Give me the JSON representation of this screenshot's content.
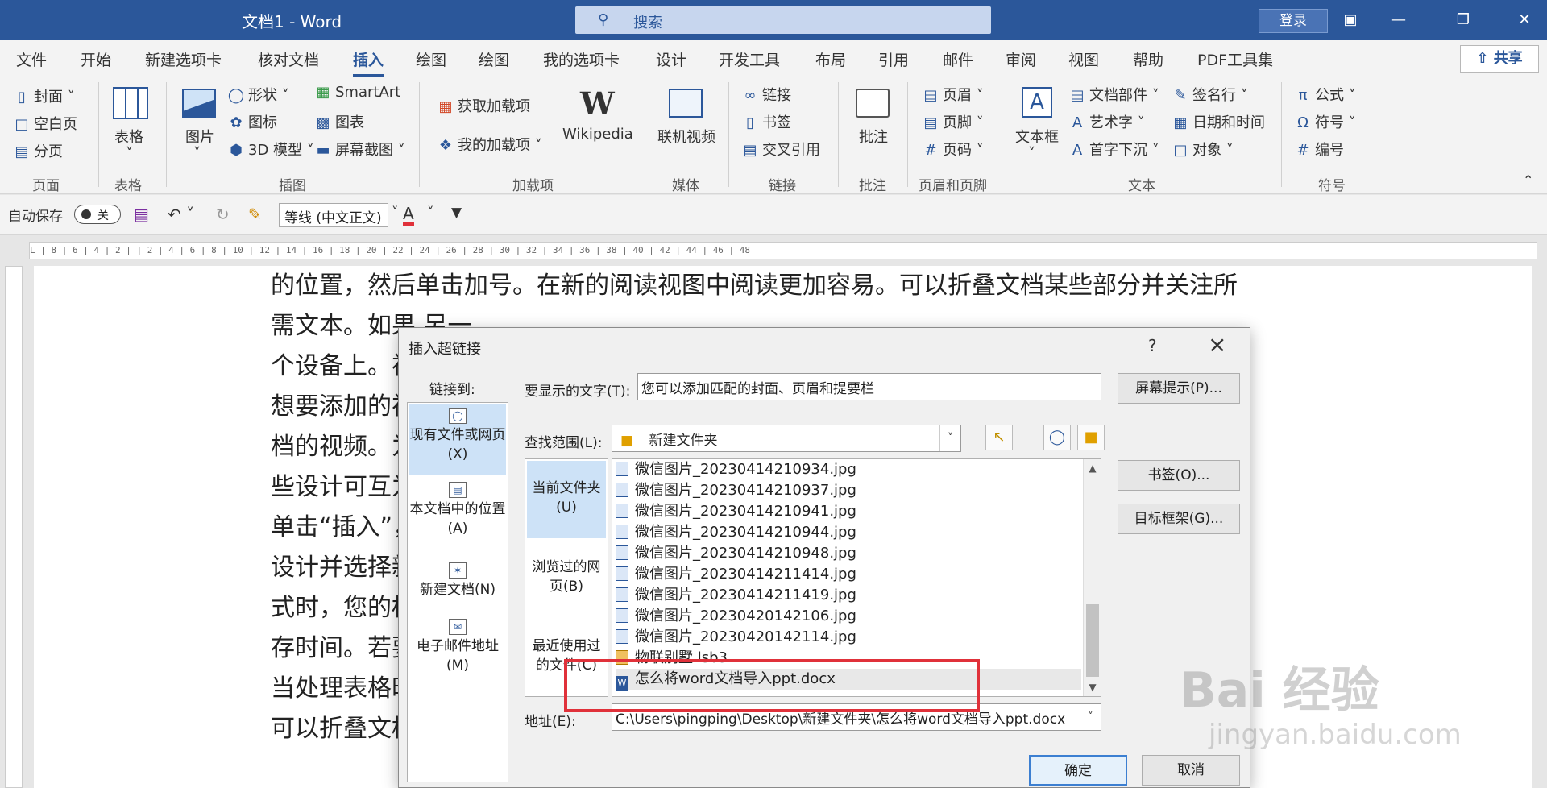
{
  "titlebar": {
    "title": "文档1  -  Word",
    "search_placeholder": "搜索",
    "login": "登录"
  },
  "tabs": [
    "文件",
    "开始",
    "新建选项卡",
    "核对文档",
    "插入",
    "绘图",
    "绘图",
    "我的选项卡",
    "设计",
    "开发工具",
    "布局",
    "引用",
    "邮件",
    "审阅",
    "视图",
    "帮助",
    "PDF工具集"
  ],
  "active_tab": "插入",
  "share": "共享",
  "ribbon": {
    "pages": [
      "封面",
      "空白页",
      "分页"
    ],
    "pages_group": "页面",
    "table": "表格",
    "table_group": "表格",
    "picture": "图片",
    "shapes": "形状",
    "icons": "图标",
    "model3d": "3D 模型",
    "smartart": "SmartArt",
    "chart": "图表",
    "screenshot": "屏幕截图",
    "illustrations_group": "插图",
    "get_addins": "获取加载项",
    "my_addins": "我的加载项",
    "wikipedia": "Wikipedia",
    "addins_group": "加载项",
    "online_video": "联机视频",
    "media_group": "媒体",
    "link": "链接",
    "bookmark": "书签",
    "crossref": "交叉引用",
    "links_group": "链接",
    "comment": "批注",
    "comment_group": "批注",
    "header": "页眉",
    "footer": "页脚",
    "pagenum": "页码",
    "hf_group": "页眉和页脚",
    "textbox": "文本框",
    "quickparts": "文档部件",
    "wordart": "艺术字",
    "dropcap": "首字下沉",
    "signature": "签名行",
    "datetime": "日期和时间",
    "object": "对象",
    "text_group": "文本",
    "equation": "公式",
    "symbol": "符号",
    "number": "编号",
    "symbols_group": "符号"
  },
  "qat": {
    "autosave": "自动保存",
    "toggle": "关",
    "font": "等线 (中文正文)"
  },
  "ruler": "L | 8 | 6 | 4 | 2 |  | 2 | 4 | 6 | 8 | 10 | 12 | 14 | 16 | 18 | 20 | 22 | 24 | 26 | 28 | 30 | 32 | 34 | 36 | 38 | 40 | 42 | 44 | 46 | 48",
  "doc_lines": [
    "的位置，然后单击加号。在新的阅读视图中阅读更加容易。可以折叠文档某些部分并关注所",
    "需文本。如果                                                                                                                       另一",
    "个设备上。视                                                                                                                       以在",
    "想要添加的视                                                                                                                       的文",
    "档的视频。为                                                                                                                       ，这",
    "些设计可互为",
    "单击“插入”，然                                                                                                                  单击",
    "设计并选择新                                                                                                                    用样",
    "式时，您的标                                                                                                                    中保",
    "存时间。若要                                                                                                                    按钮。",
    "当处理表格时                                                                                                                    易。",
    "可以折叠文档                                                                                                                    会记"
  ],
  "dialog": {
    "title": "插入超链接",
    "help": "?",
    "link_to": "链接到:",
    "link_items": [
      "现有文件或网页(X)",
      "本文档中的位置(A)",
      "新建文档(N)",
      "电子邮件地址(M)"
    ],
    "display_text_label": "要显示的文字(T):",
    "display_text": "您可以添加匹配的封面、页眉和提要栏",
    "screentip": "屏幕提示(P)...",
    "lookin_label": "查找范围(L):",
    "lookin_value": "新建文件夹",
    "sub_items": [
      "当前文件夹(U)",
      "浏览过的网页(B)",
      "最近使用过的文件(C)"
    ],
    "files": [
      "微信图片_20230414210934.jpg",
      "微信图片_20230414210937.jpg",
      "微信图片_20230414210941.jpg",
      "微信图片_20230414210944.jpg",
      "微信图片_20230414210948.jpg",
      "微信图片_20230414211414.jpg",
      "微信图片_20230414211419.jpg",
      "微信图片_20230420142106.jpg",
      "微信图片_20230420142114.jpg",
      "物联别墅.lsb3",
      "怎么将word文档导入ppt.docx"
    ],
    "bookmark_btn": "书签(O)...",
    "target_frame_btn": "目标框架(G)...",
    "address_label": "地址(E):",
    "address_value": "C:\\Users\\pingping\\Desktop\\新建文件夹\\怎么将word文档导入ppt.docx",
    "ok": "确定",
    "cancel": "取消"
  },
  "watermark": "Bai 经验",
  "watermark_sub": "jingyan.baidu.com"
}
